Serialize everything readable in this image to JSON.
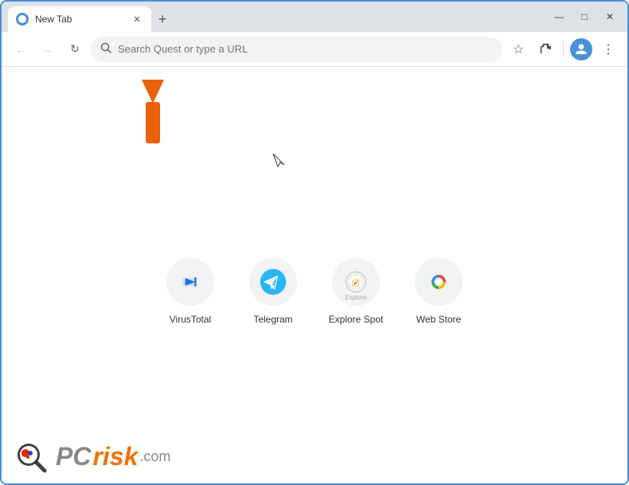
{
  "browser": {
    "tab": {
      "favicon_label": "tab-favicon",
      "title": "New Tab",
      "close_label": "✕"
    },
    "new_tab_btn": "+",
    "window_controls": {
      "minimize": "—",
      "maximize": "□",
      "close": "✕"
    },
    "toolbar": {
      "back_label": "←",
      "forward_label": "→",
      "reload_label": "↻",
      "search_placeholder": "Search Quest or type a URL",
      "bookmark_label": "☆",
      "extensions_label": "🧩",
      "profile_label": "👤",
      "menu_label": "⋮"
    }
  },
  "page": {
    "shortcuts": [
      {
        "id": "virustotal",
        "label": "VirusTotal",
        "icon_type": "vt"
      },
      {
        "id": "telegram",
        "label": "Telegram",
        "icon_type": "tg"
      },
      {
        "id": "explorespot",
        "label": "Explore Spot",
        "icon_type": "es"
      },
      {
        "id": "webstore",
        "label": "Web Store",
        "icon_type": "ws"
      }
    ]
  },
  "watermark": {
    "text_pc": "PC",
    "text_risk": "risk",
    "text_com": ".com"
  }
}
